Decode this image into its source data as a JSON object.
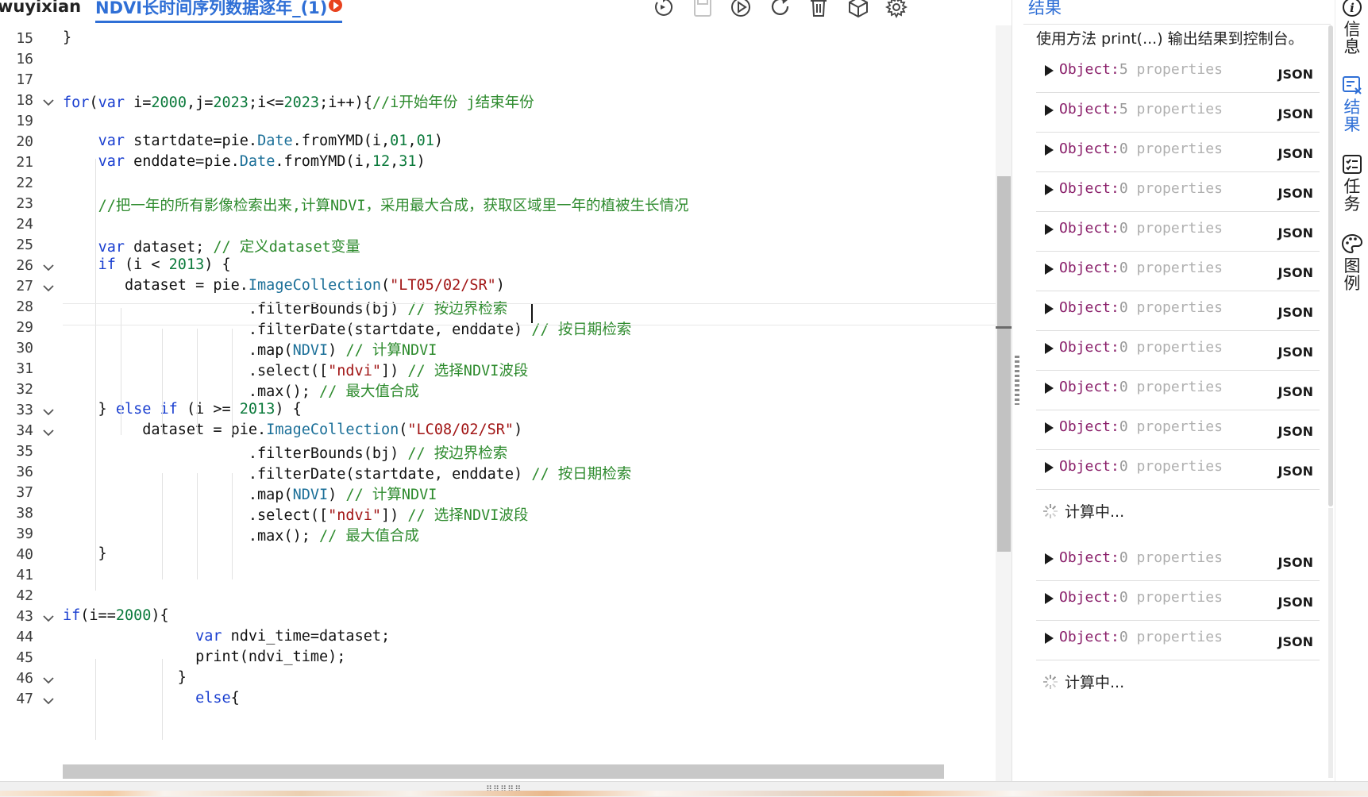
{
  "toolbar": {
    "user": "wuyixian",
    "file_title": "NDVI长时间序列数据逐年_(1)",
    "icons": [
      "reset-icon",
      "save-icon",
      "run-icon",
      "refresh-icon",
      "delete-icon",
      "package-icon",
      "settings-icon"
    ]
  },
  "editor": {
    "lines": [
      {
        "n": "15",
        "tokens": [
          {
            "t": "}",
            "c": ""
          }
        ]
      },
      {
        "n": "16",
        "tokens": []
      },
      {
        "n": "17",
        "tokens": []
      },
      {
        "n": "18",
        "fold": true,
        "tokens": [
          {
            "t": "for",
            "c": "kw"
          },
          {
            "t": "(",
            "c": ""
          },
          {
            "t": "var",
            "c": "kw"
          },
          {
            "t": " i=",
            "c": ""
          },
          {
            "t": "2000",
            "c": "num"
          },
          {
            "t": ",j=",
            "c": ""
          },
          {
            "t": "2023",
            "c": "num"
          },
          {
            "t": ";i<=",
            "c": ""
          },
          {
            "t": "2023",
            "c": "num"
          },
          {
            "t": ";i++){",
            "c": ""
          },
          {
            "t": "//i开始年份 j结束年份",
            "c": "cmt"
          }
        ]
      },
      {
        "n": "19",
        "tokens": []
      },
      {
        "n": "20",
        "tokens": [
          {
            "t": "    ",
            "c": ""
          },
          {
            "t": "var",
            "c": "kw"
          },
          {
            "t": " startdate=pie.",
            "c": ""
          },
          {
            "t": "Date",
            "c": "cls"
          },
          {
            "t": ".fromYMD(i,",
            "c": ""
          },
          {
            "t": "01",
            "c": "num"
          },
          {
            "t": ",",
            "c": ""
          },
          {
            "t": "01",
            "c": "num"
          },
          {
            "t": ")",
            "c": ""
          }
        ]
      },
      {
        "n": "21",
        "tokens": [
          {
            "t": "    ",
            "c": ""
          },
          {
            "t": "var",
            "c": "kw"
          },
          {
            "t": " enddate=pie.",
            "c": ""
          },
          {
            "t": "Date",
            "c": "cls"
          },
          {
            "t": ".fromYMD(i,",
            "c": ""
          },
          {
            "t": "12",
            "c": "num"
          },
          {
            "t": ",",
            "c": ""
          },
          {
            "t": "31",
            "c": "num"
          },
          {
            "t": ")",
            "c": ""
          }
        ]
      },
      {
        "n": "22",
        "tokens": []
      },
      {
        "n": "23",
        "tokens": [
          {
            "t": "    ",
            "c": ""
          },
          {
            "t": "//把一年的所有影像检索出来,计算NDVI，采用最大合成，获取区域里一年的植被生长情况",
            "c": "cmt"
          }
        ]
      },
      {
        "n": "24",
        "tokens": []
      },
      {
        "n": "25",
        "tokens": [
          {
            "t": "    ",
            "c": ""
          },
          {
            "t": "var",
            "c": "kw"
          },
          {
            "t": " dataset; ",
            "c": ""
          },
          {
            "t": "// 定义dataset变量",
            "c": "cmt"
          }
        ]
      },
      {
        "n": "26",
        "fold": true,
        "tokens": [
          {
            "t": "    ",
            "c": ""
          },
          {
            "t": "if",
            "c": "kw"
          },
          {
            "t": " (i < ",
            "c": ""
          },
          {
            "t": "2013",
            "c": "num"
          },
          {
            "t": ") {",
            "c": ""
          }
        ]
      },
      {
        "n": "27",
        "fold": true,
        "tokens": [
          {
            "t": "       dataset = pie.",
            "c": ""
          },
          {
            "t": "ImageCollection",
            "c": "cls"
          },
          {
            "t": "(",
            "c": ""
          },
          {
            "t": "\"LT05/02/SR\"",
            "c": "str"
          },
          {
            "t": ")",
            "c": ""
          }
        ]
      },
      {
        "n": "28",
        "tokens": [
          {
            "t": "                     .filterBounds(bj) ",
            "c": ""
          },
          {
            "t": "// 按边界检索",
            "c": "cmt"
          }
        ]
      },
      {
        "n": "29",
        "tokens": [
          {
            "t": "                     .filterDate(startdate, enddate) ",
            "c": ""
          },
          {
            "t": "// 按日期检索",
            "c": "cmt"
          }
        ]
      },
      {
        "n": "30",
        "tokens": [
          {
            "t": "                     .map(",
            "c": ""
          },
          {
            "t": "NDVI",
            "c": "cls"
          },
          {
            "t": ") ",
            "c": ""
          },
          {
            "t": "// 计算NDVI",
            "c": "cmt"
          }
        ]
      },
      {
        "n": "31",
        "tokens": [
          {
            "t": "                     .select([",
            "c": ""
          },
          {
            "t": "\"ndvi\"",
            "c": "str"
          },
          {
            "t": "]) ",
            "c": ""
          },
          {
            "t": "// 选择NDVI波段",
            "c": "cmt"
          }
        ]
      },
      {
        "n": "32",
        "tokens": [
          {
            "t": "                     .max(); ",
            "c": ""
          },
          {
            "t": "// 最大值合成",
            "c": "cmt"
          }
        ]
      },
      {
        "n": "33",
        "fold": true,
        "tokens": [
          {
            "t": "    } ",
            "c": ""
          },
          {
            "t": "else",
            "c": "kw"
          },
          {
            "t": " ",
            "c": ""
          },
          {
            "t": "if",
            "c": "kw"
          },
          {
            "t": " (i >= ",
            "c": ""
          },
          {
            "t": "2013",
            "c": "num"
          },
          {
            "t": ") {",
            "c": ""
          }
        ]
      },
      {
        "n": "34",
        "fold": true,
        "tokens": [
          {
            "t": "         dataset = pie.",
            "c": ""
          },
          {
            "t": "ImageCollection",
            "c": "cls"
          },
          {
            "t": "(",
            "c": ""
          },
          {
            "t": "\"LC08/02/SR\"",
            "c": "str"
          },
          {
            "t": ")",
            "c": ""
          }
        ]
      },
      {
        "n": "35",
        "tokens": [
          {
            "t": "                     .filterBounds(bj) ",
            "c": ""
          },
          {
            "t": "// 按边界检索",
            "c": "cmt"
          }
        ]
      },
      {
        "n": "36",
        "tokens": [
          {
            "t": "                     .filterDate(startdate, enddate) ",
            "c": ""
          },
          {
            "t": "// 按日期检索",
            "c": "cmt"
          }
        ]
      },
      {
        "n": "37",
        "tokens": [
          {
            "t": "                     .map(",
            "c": ""
          },
          {
            "t": "NDVI",
            "c": "cls"
          },
          {
            "t": ") ",
            "c": ""
          },
          {
            "t": "// 计算NDVI",
            "c": "cmt"
          }
        ]
      },
      {
        "n": "38",
        "tokens": [
          {
            "t": "                     .select([",
            "c": ""
          },
          {
            "t": "\"ndvi\"",
            "c": "str"
          },
          {
            "t": "]) ",
            "c": ""
          },
          {
            "t": "// 选择NDVI波段",
            "c": "cmt"
          }
        ]
      },
      {
        "n": "39",
        "tokens": [
          {
            "t": "                     .max(); ",
            "c": ""
          },
          {
            "t": "// 最大值合成",
            "c": "cmt"
          }
        ]
      },
      {
        "n": "40",
        "tokens": [
          {
            "t": "    }",
            "c": ""
          }
        ]
      },
      {
        "n": "41",
        "tokens": []
      },
      {
        "n": "42",
        "tokens": []
      },
      {
        "n": "43",
        "fold": true,
        "tokens": [
          {
            "t": "if",
            "c": "kw"
          },
          {
            "t": "(i==",
            "c": ""
          },
          {
            "t": "2000",
            "c": "num"
          },
          {
            "t": "){",
            "c": ""
          }
        ]
      },
      {
        "n": "44",
        "tokens": [
          {
            "t": "               ",
            "c": ""
          },
          {
            "t": "var",
            "c": "kw"
          },
          {
            "t": " ndvi_time=dataset;",
            "c": ""
          }
        ]
      },
      {
        "n": "45",
        "tokens": [
          {
            "t": "               print(ndvi_time);",
            "c": ""
          }
        ]
      },
      {
        "n": "46",
        "fold": true,
        "tokens": [
          {
            "t": "             }",
            "c": ""
          }
        ]
      },
      {
        "n": "47",
        "fold": true,
        "tokens": [
          {
            "t": "               ",
            "c": ""
          },
          {
            "t": "else",
            "c": "kw"
          },
          {
            "t": "{",
            "c": ""
          }
        ]
      }
    ]
  },
  "results": {
    "title": "结果",
    "usage": "使用方法 print(...) 输出结果到控制台。",
    "json_label": "JSON",
    "object_prefix": "Object:",
    "properties_suffix": " properties",
    "computing_label": "计算中...",
    "rows": [
      {
        "type": "object",
        "count": "5"
      },
      {
        "type": "object",
        "count": "5"
      },
      {
        "type": "object",
        "count": "0"
      },
      {
        "type": "object",
        "count": "0"
      },
      {
        "type": "object",
        "count": "0"
      },
      {
        "type": "object",
        "count": "0"
      },
      {
        "type": "object",
        "count": "0"
      },
      {
        "type": "object",
        "count": "0"
      },
      {
        "type": "object",
        "count": "0"
      },
      {
        "type": "object",
        "count": "0"
      },
      {
        "type": "object",
        "count": "0"
      },
      {
        "type": "computing"
      },
      {
        "type": "object",
        "count": "0"
      },
      {
        "type": "object",
        "count": "0"
      },
      {
        "type": "object",
        "count": "0"
      },
      {
        "type": "computing"
      }
    ]
  },
  "side_rail": {
    "items": [
      {
        "icon": "info-icon",
        "label": "信息",
        "active": false
      },
      {
        "icon": "results-icon",
        "label": "结果",
        "active": true
      },
      {
        "icon": "task-icon",
        "label": "任务",
        "active": false
      },
      {
        "icon": "palette-icon",
        "label": "图例",
        "active": false
      }
    ]
  },
  "colors": {
    "accent": "#2f6fd6",
    "keyword": "#1a3fd0",
    "number": "#0b7a3b",
    "string": "#a11515",
    "comment": "#2e8b2e",
    "class": "#1b6f98",
    "object_label": "#8a1f6a",
    "close_button": "#e8421e"
  }
}
